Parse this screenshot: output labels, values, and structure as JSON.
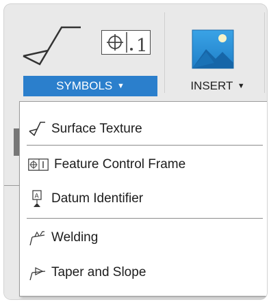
{
  "ribbon": {
    "fcf_icon_text": "⊕.1",
    "symbols_label": "SYMBOLS",
    "insert_label": "INSERT",
    "caret": "▼"
  },
  "menu": {
    "items": [
      {
        "label": "Surface Texture",
        "icon": "surface-texture-icon"
      },
      {
        "label": "Feature Control Frame",
        "icon": "feature-control-frame-icon"
      },
      {
        "label": "Datum Identifier",
        "icon": "datum-identifier-icon"
      },
      {
        "label": "Welding",
        "icon": "welding-icon"
      },
      {
        "label": "Taper and Slope",
        "icon": "taper-slope-icon"
      }
    ]
  },
  "colors": {
    "accent": "#2b7fcc",
    "background": "#e9e9e9",
    "menu_bg": "#ffffff"
  }
}
